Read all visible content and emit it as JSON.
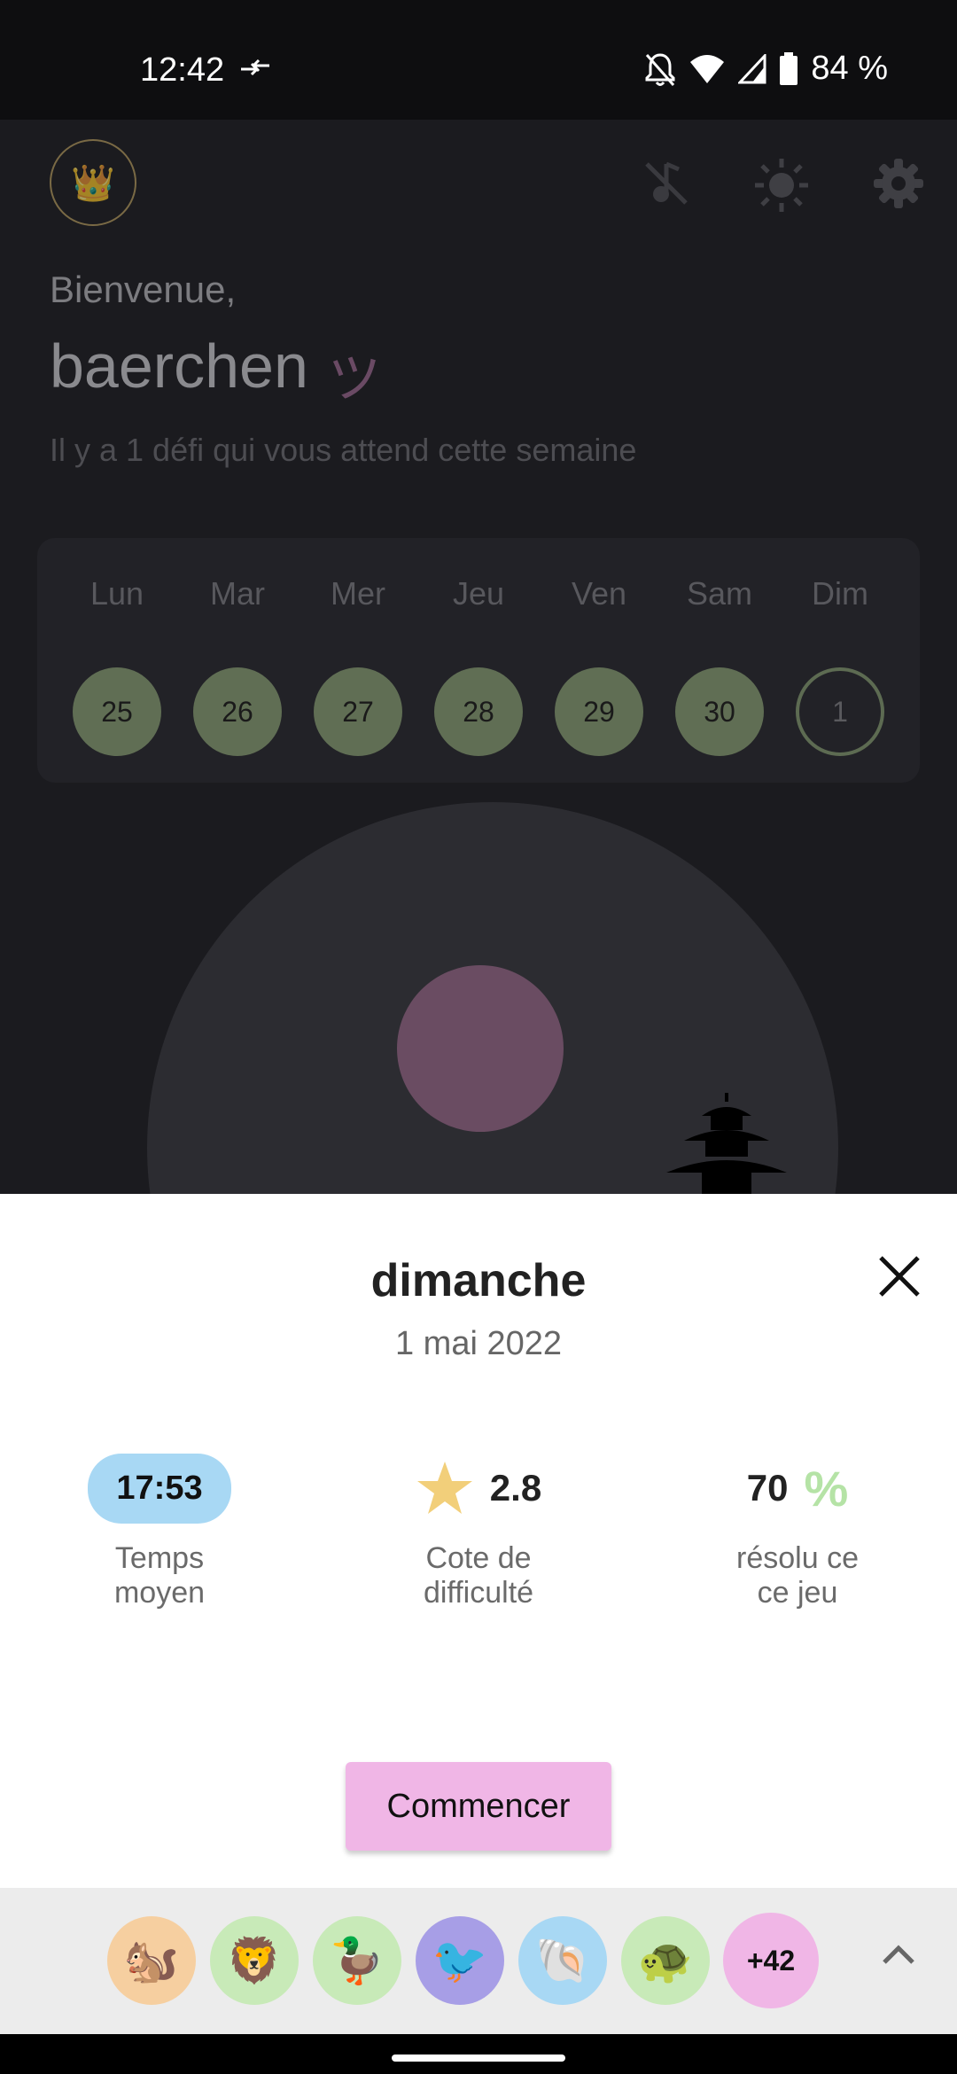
{
  "status_bar": {
    "time": "12:42",
    "battery": "84 %"
  },
  "header": {
    "crown_icon": "👑",
    "greeting": "Bienvenue,",
    "username": "baerchen",
    "username_symbol": "ツ",
    "subtitle": "Il y a 1 défi qui vous attend cette semaine"
  },
  "week": [
    {
      "day": "Lun",
      "date": "25",
      "completed": true
    },
    {
      "day": "Mar",
      "date": "26",
      "completed": true
    },
    {
      "day": "Mer",
      "date": "27",
      "completed": true
    },
    {
      "day": "Jeu",
      "date": "28",
      "completed": true
    },
    {
      "day": "Ven",
      "date": "29",
      "completed": true
    },
    {
      "day": "Sam",
      "date": "30",
      "completed": true
    },
    {
      "day": "Dim",
      "date": "1",
      "completed": false
    }
  ],
  "sheet": {
    "title": "dimanche",
    "date": "1 mai 2022",
    "stats": {
      "avg_time": {
        "value": "17:53",
        "label_line1": "Temps",
        "label_line2": "moyen"
      },
      "difficulty": {
        "value": "2.8",
        "label_line1": "Cote de",
        "label_line2": "difficulté"
      },
      "solved": {
        "value": "70",
        "unit": "%",
        "label_line1": "résolu ce",
        "label_line2": "ce jeu"
      }
    },
    "start_button": "Commencer"
  },
  "avatars": [
    {
      "emoji": "🐿️",
      "color": "#f6cfa0"
    },
    {
      "emoji": "🦁",
      "color": "#c8eab8"
    },
    {
      "emoji": "🦆",
      "color": "#c8eab8"
    },
    {
      "emoji": "🐦",
      "color": "#a79ee6"
    },
    {
      "emoji": "🐚",
      "color": "#a8d8f4"
    },
    {
      "emoji": "🐢",
      "color": "#c8eab8"
    }
  ],
  "more_avatars": "+42",
  "colors": {
    "completed_day": "#606e54",
    "start_button": "#f0b6e6",
    "time_pill": "#a8d8f4",
    "star": "#f2cf7a",
    "percent": "#b5e3a6"
  }
}
